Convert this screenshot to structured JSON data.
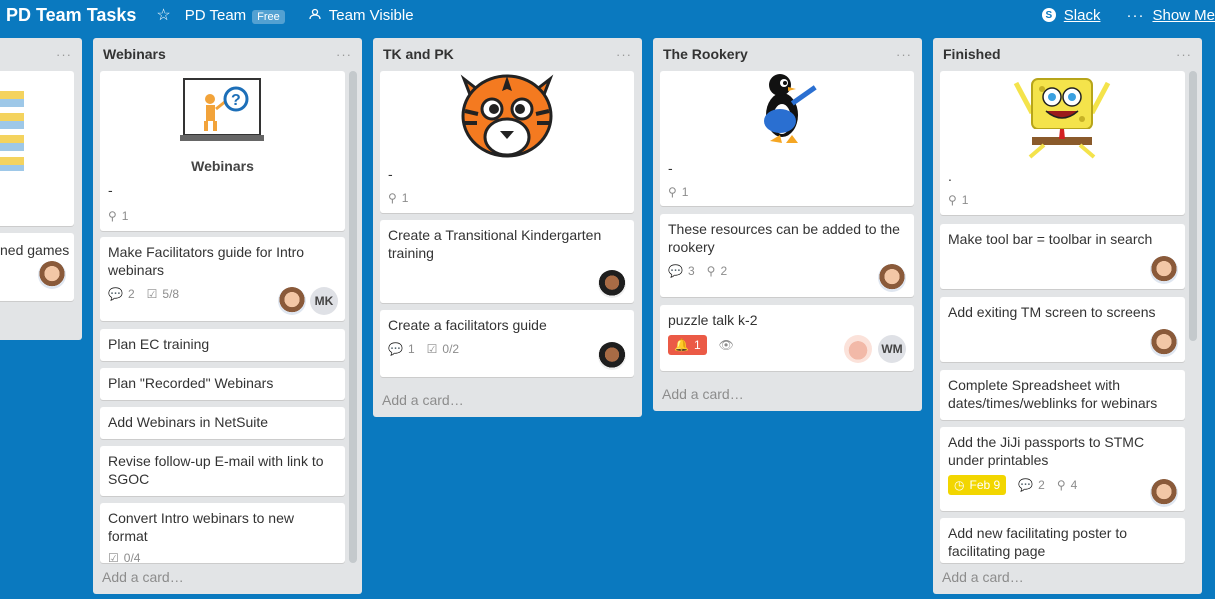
{
  "header": {
    "title": "PD Team Tasks",
    "team": "PD Team",
    "plan": "Free",
    "visibility": "Team Visible",
    "slack": "Slack",
    "more": "···",
    "show_menu": "Show Me"
  },
  "lists": [
    {
      "title": "",
      "cards": [
        {
          "title": "ned games"
        }
      ]
    },
    {
      "title": "Webinars",
      "menu": "···",
      "cover_caption": "Webinars",
      "cards": [
        {
          "title": "-",
          "attachments": "1"
        },
        {
          "title": "Make Facilitators guide for Intro webinars",
          "comments": "2",
          "checklist": "5/8",
          "member_initials": "MK"
        },
        {
          "title": "Plan EC training"
        },
        {
          "title": "Plan \"Recorded\" Webinars"
        },
        {
          "title": "Add Webinars in NetSuite"
        },
        {
          "title": "Revise follow-up E-mail with link to SGOC"
        },
        {
          "title": "Convert Intro webinars to new format",
          "checklist": "0/4"
        }
      ],
      "add_card": "Add a card…"
    },
    {
      "title": "TK and PK",
      "menu": "···",
      "cards": [
        {
          "title": "-",
          "attachments": "1"
        },
        {
          "title": "Create a Transitional Kindergarten training"
        },
        {
          "title": "Create a facilitators guide",
          "comments": "1",
          "checklist": "0/2"
        }
      ],
      "add_card": "Add a card…"
    },
    {
      "title": "The Rookery",
      "menu": "···",
      "cards": [
        {
          "title": "-",
          "attachments": "1"
        },
        {
          "title": "These resources can be added to the rookery",
          "comments": "3",
          "attachments": "2"
        },
        {
          "title": "puzzle talk k-2",
          "notifications": "1",
          "member_initials": "WM"
        }
      ],
      "add_card": "Add a card…"
    },
    {
      "title": "Finished",
      "menu": "···",
      "cards": [
        {
          "title": ".",
          "attachments": "1"
        },
        {
          "title": "Make tool bar = toolbar in search"
        },
        {
          "title": "Add exiting TM screen to screens"
        },
        {
          "title": "Complete Spreadsheet with dates/times/weblinks for webinars"
        },
        {
          "title": "Add the JiJi passports to STMC under printables",
          "due": "Feb 9",
          "comments": "2",
          "attachments": "4"
        },
        {
          "title": "Add new facilitating poster to facilitating page"
        }
      ],
      "add_card": "Add a card…"
    }
  ],
  "colors": {
    "board_background": "#0a79bf",
    "list_background": "#e2e4e6",
    "label_red": "#eb5a46",
    "label_yellow": "#f2d600"
  },
  "icons": [
    "star-icon",
    "team-visible-icon",
    "slack-icon",
    "attachment-icon",
    "comment-icon",
    "checklist-icon",
    "bell-icon",
    "watch-eye-icon",
    "clock-icon"
  ]
}
